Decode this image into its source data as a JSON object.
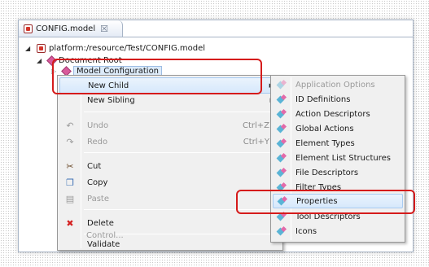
{
  "editor_tab": {
    "title": "CONFIG.model",
    "close": "☒"
  },
  "tree": {
    "resource_path": "platform:/resource/Test/CONFIG.model",
    "document_root": "Document Root",
    "model_configuration": "Model Configuration"
  },
  "context_menu": {
    "items": [
      {
        "label": "New Child",
        "has_submenu": true
      },
      {
        "label": "New Sibling",
        "has_submenu": true
      },
      {
        "label": "Undo",
        "shortcut": "Ctrl+Z"
      },
      {
        "label": "Redo",
        "shortcut": "Ctrl+Y"
      },
      {
        "label": "Cut"
      },
      {
        "label": "Copy"
      },
      {
        "label": "Paste"
      },
      {
        "label": "Delete"
      },
      {
        "label": "Validate"
      },
      {
        "label": "Control..."
      }
    ]
  },
  "submenu": {
    "items": [
      "Application Options",
      "ID Definitions",
      "Action Descriptors",
      "Global Actions",
      "Element Types",
      "Element List Structures",
      "File Descriptors",
      "Filter Types",
      "Properties",
      "Tool Descriptors",
      "Icons"
    ]
  },
  "colors": {
    "highlight_red": "#d51b1b",
    "menu_bg": "#f0f0f0",
    "selection_blue": "#d6e8fb"
  }
}
